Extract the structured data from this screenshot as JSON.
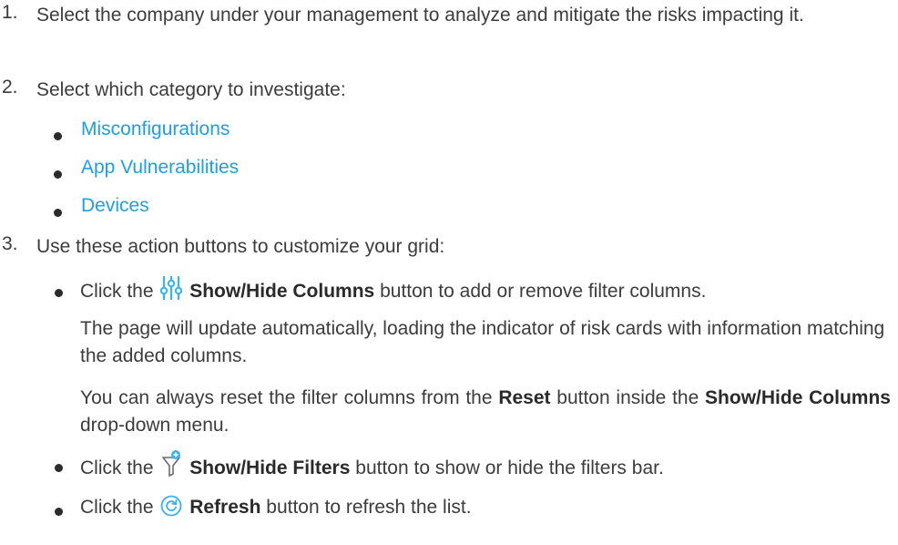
{
  "steps": [
    {
      "num": "1.",
      "text": "Select the company under your management to analyze and mitigate the risks impacting it."
    },
    {
      "num": "2.",
      "text": "Select which category to investigate:",
      "links": [
        "Misconfigurations",
        "App Vulnerabilities",
        "Devices"
      ]
    },
    {
      "num": "3.",
      "text": "Use these action buttons to customize your grid:",
      "bullets": {
        "columns": {
          "pre": "Click the",
          "bold": "Show/Hide Columns",
          "post": "button to add or remove filter columns.",
          "icon": "sliders-icon",
          "para1": "The page will update automatically, loading the indicator of risk cards with information matching the added columns.",
          "para2_pre": "You can always reset the filter columns from the",
          "para2_bold1": "Reset",
          "para2_mid": "button inside the",
          "para2_bold2": "Show/Hide Columns",
          "para2_post": "drop-down menu."
        },
        "filters": {
          "pre": "Click the",
          "bold": "Show/Hide Filters",
          "post": "button to show or hide the filters bar.",
          "icon": "filter-icon"
        },
        "refresh": {
          "pre": "Click the",
          "bold": "Refresh",
          "post": "button to refresh the list.",
          "icon": "refresh-icon"
        }
      }
    }
  ],
  "colors": {
    "link": "#1f9ee0",
    "icon": "#36b3f0",
    "text": "#3c3c3c"
  }
}
